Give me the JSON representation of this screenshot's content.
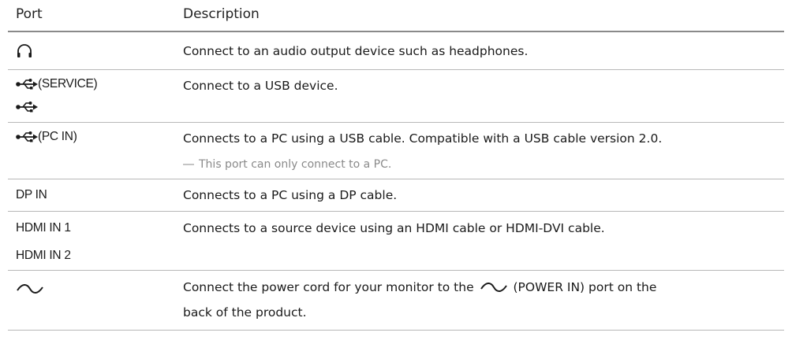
{
  "table": {
    "headers": {
      "port": "Port",
      "description": "Description"
    },
    "rows": [
      {
        "port_icon": "headphone-icon",
        "description": "Connect to an audio output device such as headphones."
      },
      {
        "port_label_1": "(SERVICE)",
        "port_icon_1": "usb-icon",
        "port_icon_2": "usb-icon",
        "description": "Connect to a USB device."
      },
      {
        "port_label": "(PC IN)",
        "port_icon": "usb-icon",
        "description": "Connects to a PC using a USB cable. Compatible with a USB cable version 2.0.",
        "note_dash": "―",
        "note": "This port can only connect to a PC."
      },
      {
        "port_label": "DP IN",
        "description": "Connects to a PC using a DP cable."
      },
      {
        "port_label_1": "HDMI IN 1",
        "port_label_2": "HDMI IN 2",
        "description": "Connects to a source device using an HDMI cable or HDMI-DVI cable."
      },
      {
        "port_icon": "ac-power-icon",
        "description_before": "Connect the power cord for your monitor to the",
        "description_icon": "ac-power-icon",
        "description_after": "(POWER IN) port on the",
        "description_line2": "back of the product."
      }
    ]
  }
}
